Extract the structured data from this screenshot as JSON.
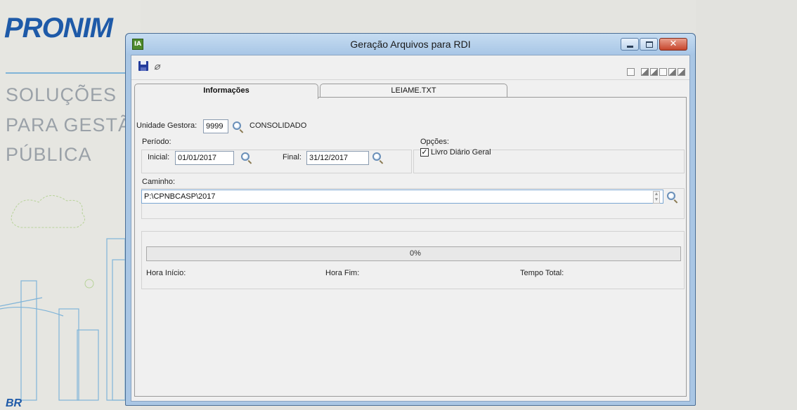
{
  "wallpaper": {
    "brand": "PRONIM",
    "brand_top": "518",
    "slogan_lines": [
      "SOLUÇÕES",
      "PARA GESTÃ",
      "PÚBLICA"
    ],
    "footer_brand": "BR"
  },
  "window": {
    "app_icon": "IA",
    "title": "Geração Arquivos para RDI",
    "close_glyph": "✕"
  },
  "toolbar": {
    "save": "save-icon",
    "clear": "eraser-icon"
  },
  "tabs": [
    {
      "label": "Informações",
      "active": true
    },
    {
      "label": "LEIAME.TXT",
      "active": false
    }
  ],
  "form": {
    "unidade_label": "Unidade Gestora:",
    "unidade_value": "9999",
    "unidade_desc": "CONSOLIDADO",
    "periodo_label": "Período:",
    "inicial_label": "Inicial:",
    "inicial_value": "01/01/2017",
    "final_label": "Final:",
    "final_value": "31/12/2017",
    "opcoes_label": "Opções:",
    "livro_label": "Livro Diário Geral",
    "livro_checked": true,
    "caminho_label": "Caminho:",
    "caminho_value": "P:\\CPNBCASP\\2017"
  },
  "progress": {
    "percent": 0,
    "text": "0%",
    "hora_inicio_label": "Hora Início:",
    "hora_fim_label": "Hora Fim:",
    "tempo_total_label": "Tempo Total:"
  },
  "colors": {
    "brand_blue": "#1e5aa8",
    "window_frame": "#a9c6e4",
    "close_red": "#c6452c",
    "progress_fill": "#3bb04a"
  }
}
